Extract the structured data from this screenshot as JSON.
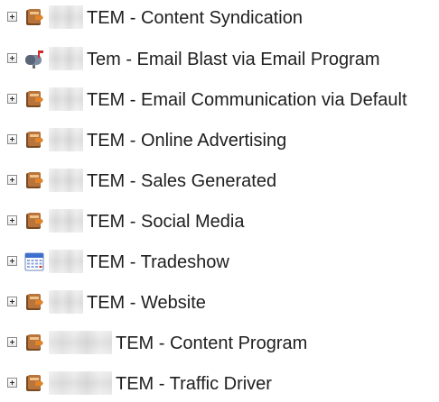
{
  "tree": {
    "items": [
      {
        "label": "TEM - Content Syndication",
        "icon": "program-folder-icon",
        "redacted": "short"
      },
      {
        "label": "Tem - Email Blast via Email Program",
        "icon": "email-program-icon",
        "redacted": "short"
      },
      {
        "label": "TEM - Email Communication via Default",
        "icon": "program-folder-icon",
        "redacted": "short"
      },
      {
        "label": "TEM - Online Advertising",
        "icon": "program-folder-icon",
        "redacted": "short"
      },
      {
        "label": "TEM - Sales Generated",
        "icon": "program-folder-icon",
        "redacted": "short"
      },
      {
        "label": "TEM - Social Media",
        "icon": "program-folder-icon",
        "redacted": "short"
      },
      {
        "label": "TEM - Tradeshow",
        "icon": "event-calendar-icon",
        "redacted": "short"
      },
      {
        "label": "TEM - Website",
        "icon": "program-folder-icon",
        "redacted": "short"
      },
      {
        "label": "TEM - Content Program",
        "icon": "program-folder-icon",
        "redacted": "long"
      },
      {
        "label": "TEM - Traffic Driver",
        "icon": "program-folder-icon",
        "redacted": "long"
      }
    ]
  },
  "colors": {
    "folder_brown": "#8b5a2b",
    "folder_orange": "#e0852a",
    "mail_red": "#d12c2c",
    "calendar_blue": "#3d6fd1"
  }
}
